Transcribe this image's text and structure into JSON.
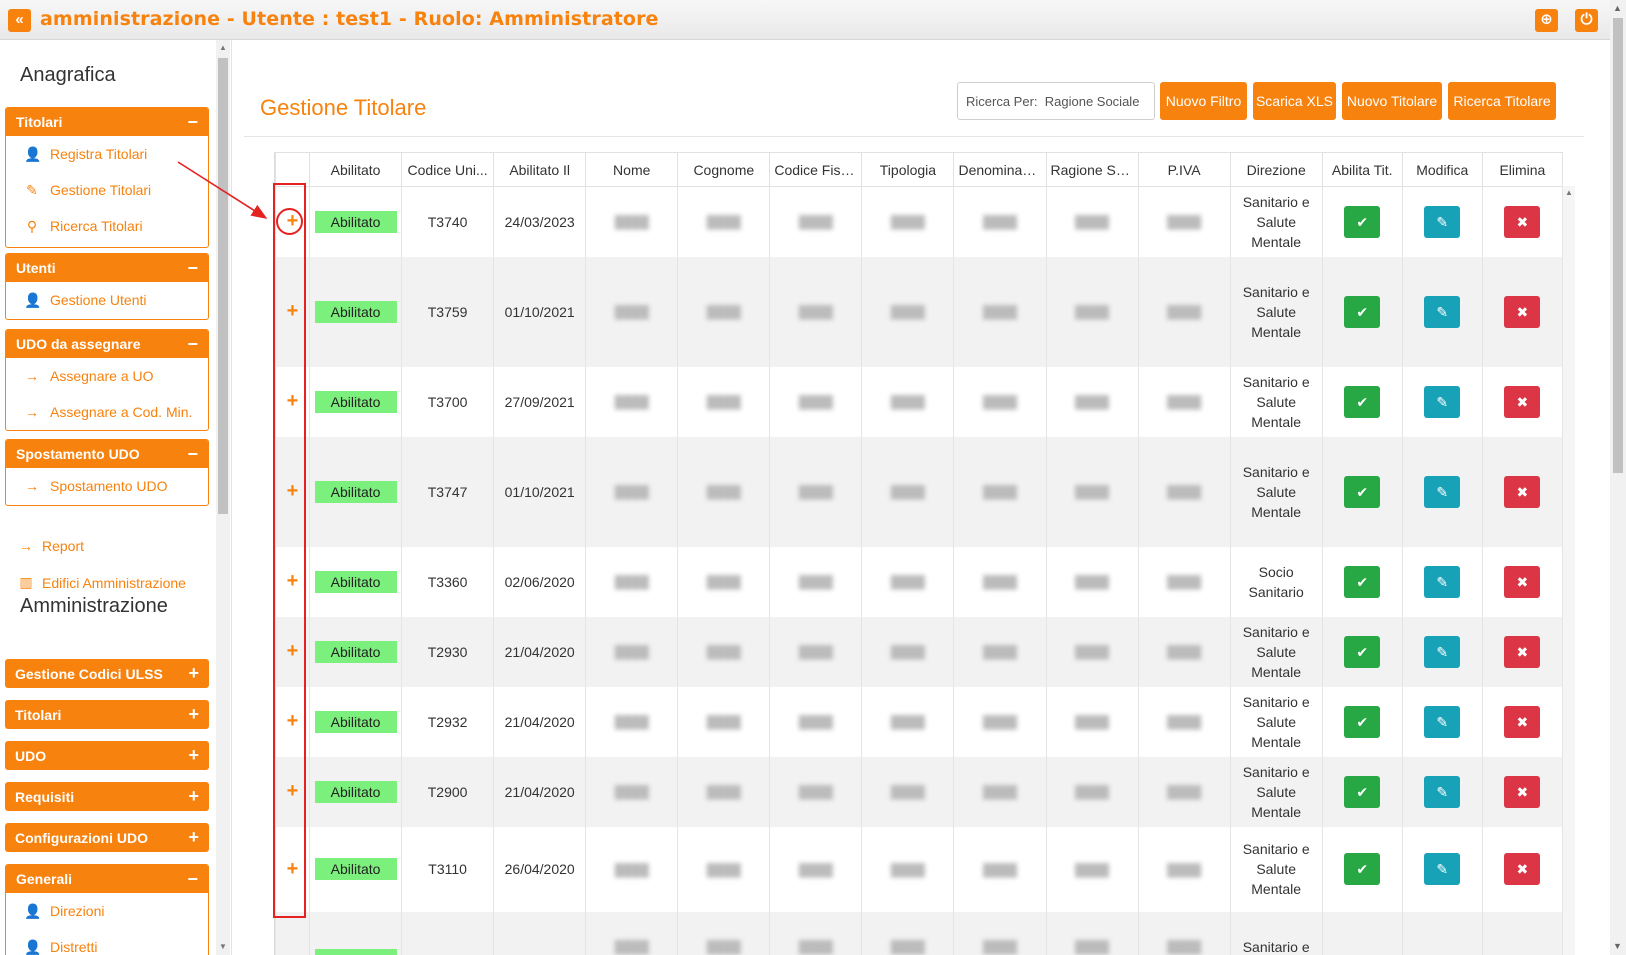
{
  "header": {
    "collapse_icon": "«",
    "title": "amministrazione - Utente : test1 - Ruolo: Amministratore",
    "globe_icon": "⊕",
    "power_icon": "⏻"
  },
  "sidebar": {
    "anagrafica_heading": "Anagrafica",
    "amministrazione_heading": "Amministrazione",
    "titolari": {
      "title": "Titolari",
      "toggle": "−",
      "items": [
        {
          "label": "Registra Titolari",
          "icon": "user-plus-icon"
        },
        {
          "label": "Gestione Titolari",
          "icon": "edit-icon"
        },
        {
          "label": "Ricerca Titolari",
          "icon": "search-icon"
        }
      ]
    },
    "utenti": {
      "title": "Utenti",
      "toggle": "−",
      "items": [
        {
          "label": "Gestione Utenti",
          "icon": "user-icon"
        }
      ]
    },
    "udo_assegnare": {
      "title": "UDO da assegnare",
      "toggle": "−",
      "items": [
        {
          "label": "Assegnare a UO",
          "icon": "arrow-right-icon"
        },
        {
          "label": "Assegnare a Cod. Min.",
          "icon": "arrow-right-icon"
        }
      ]
    },
    "spostamento": {
      "title": "Spostamento UDO",
      "toggle": "−",
      "items": [
        {
          "label": "Spostamento UDO",
          "icon": "arrow-right-icon"
        }
      ]
    },
    "report": "Report",
    "edifici": "Edifici Amministrazione",
    "collapsed": [
      {
        "label": "Gestione Codici ULSS",
        "toggle": "+"
      },
      {
        "label": "Titolari",
        "toggle": "+"
      },
      {
        "label": "UDO",
        "toggle": "+"
      },
      {
        "label": "Requisiti",
        "toggle": "+"
      },
      {
        "label": "Configurazioni UDO",
        "toggle": "+"
      }
    ],
    "generali": {
      "title": "Generali",
      "toggle": "−",
      "items": [
        {
          "label": "Direzioni",
          "icon": "user-icon"
        },
        {
          "label": "Distretti",
          "icon": "user-icon"
        }
      ]
    }
  },
  "main": {
    "title": "Gestione Titolare",
    "search": {
      "value": "Ricerca Per:  Ragione Sociale"
    },
    "buttons": {
      "nuovo_filtro": "Nuovo Filtro",
      "scarica_xls": "Scarica XLS",
      "nuovo_titolare": "Nuovo Titolare",
      "ricerca_titolare": "Ricerca Titolare"
    },
    "columns": [
      "",
      "Abilitato",
      "Codice Uni...",
      "Abilitato Il",
      "Nome",
      "Cognome",
      "Codice Fisc...",
      "Tipologia",
      "Denominazi...",
      "Ragione So...",
      "P.IVA",
      "Direzione",
      "Abilita Tit.",
      "Modifica",
      "Elimina"
    ],
    "expand_symbol": "+",
    "action_icons": {
      "abilita": "✔",
      "modifica": "✎",
      "elimina": "✖"
    },
    "rows": [
      {
        "stato": "Abilitato",
        "codice": "T3740",
        "data": "24/03/2023",
        "direzione": "Sanitario e Salute Mentale"
      },
      {
        "stato": "Abilitato",
        "codice": "T3759",
        "data": "01/10/2021",
        "direzione": "Sanitario e Salute Mentale"
      },
      {
        "stato": "Abilitato",
        "codice": "T3700",
        "data": "27/09/2021",
        "direzione": "Sanitario e Salute Mentale"
      },
      {
        "stato": "Abilitato",
        "codice": "T3747",
        "data": "01/10/2021",
        "direzione": "Sanitario e Salute Mentale"
      },
      {
        "stato": "Abilitato",
        "codice": "T3360",
        "data": "02/06/2020",
        "direzione": "Socio Sanitario"
      },
      {
        "stato": "Abilitato",
        "codice": "T2930",
        "data": "21/04/2020",
        "direzione": "Sanitario e Salute Mentale"
      },
      {
        "stato": "Abilitato",
        "codice": "T2932",
        "data": "21/04/2020",
        "direzione": "Sanitario e Salute Mentale"
      },
      {
        "stato": "Abilitato",
        "codice": "T2900",
        "data": "21/04/2020",
        "direzione": "Sanitario e Salute Mentale"
      },
      {
        "stato": "Abilitato",
        "codice": "T3110",
        "data": "26/04/2020",
        "direzione": "Sanitario e Salute Mentale"
      },
      {
        "stato": "",
        "codice": "",
        "data": "",
        "direzione": "Sanitario e"
      }
    ]
  },
  "colors": {
    "accent": "#f7820e",
    "badge_green": "#7cf07c",
    "btn_green": "#28a745",
    "btn_blue": "#17a2b8",
    "btn_red": "#dc3545",
    "annotation_red": "#e52222"
  }
}
